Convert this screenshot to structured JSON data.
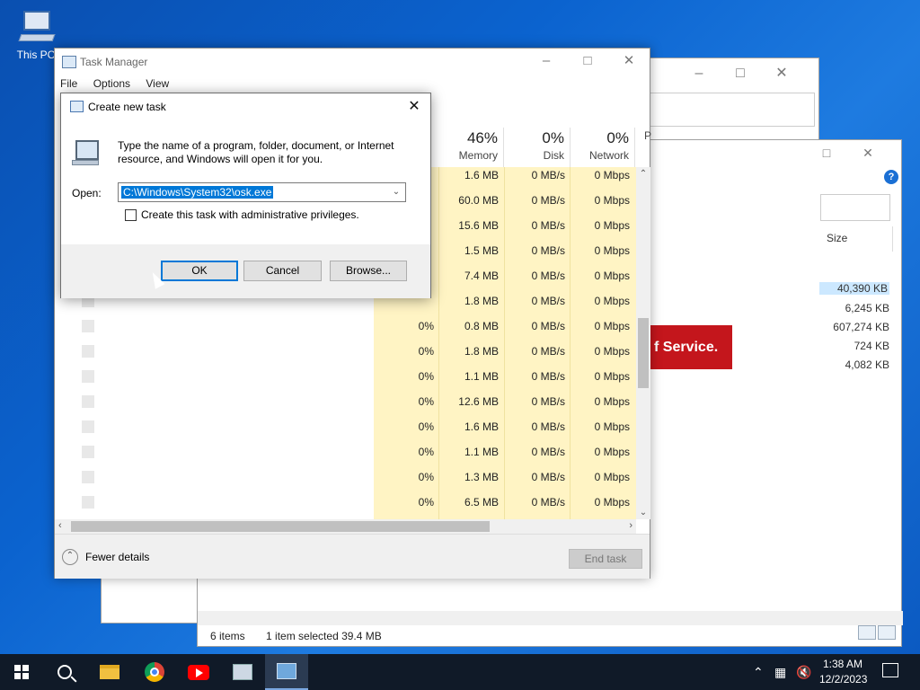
{
  "desktop": {
    "icon_label": "This PC"
  },
  "banner": {
    "text": "f Service."
  },
  "explorer": {
    "sizes_header": "Size",
    "sizes": [
      "40,390 KB",
      "6,245 KB",
      "607,274 KB",
      "724 KB",
      "4,082 KB"
    ],
    "status_items": "6 items",
    "status_selected": "1 item selected  39.4 MB"
  },
  "task_manager": {
    "title": "Task Manager",
    "menu": [
      "File",
      "Options",
      "View"
    ],
    "columns": [
      {
        "pct": "46%",
        "name": "Memory"
      },
      {
        "pct": "0%",
        "name": "Disk"
      },
      {
        "pct": "0%",
        "name": "Network"
      },
      {
        "pct": "",
        "name": "P"
      }
    ],
    "rows": [
      {
        "cpu": "",
        "mem": "1.6 MB",
        "disk": "0 MB/s",
        "net": "0 Mbps"
      },
      {
        "cpu": "",
        "mem": "60.0 MB",
        "disk": "0 MB/s",
        "net": "0 Mbps"
      },
      {
        "cpu": "",
        "mem": "15.6 MB",
        "disk": "0 MB/s",
        "net": "0 Mbps"
      },
      {
        "cpu": "",
        "mem": "1.5 MB",
        "disk": "0 MB/s",
        "net": "0 Mbps"
      },
      {
        "cpu": "",
        "mem": "7.4 MB",
        "disk": "0 MB/s",
        "net": "0 Mbps"
      },
      {
        "cpu": "",
        "mem": "1.8 MB",
        "disk": "0 MB/s",
        "net": "0 Mbps"
      },
      {
        "cpu": "0%",
        "mem": "0.8 MB",
        "disk": "0 MB/s",
        "net": "0 Mbps"
      },
      {
        "cpu": "0%",
        "mem": "1.8 MB",
        "disk": "0 MB/s",
        "net": "0 Mbps"
      },
      {
        "cpu": "0%",
        "mem": "1.1 MB",
        "disk": "0 MB/s",
        "net": "0 Mbps"
      },
      {
        "cpu": "0%",
        "mem": "12.6 MB",
        "disk": "0 MB/s",
        "net": "0 Mbps"
      },
      {
        "cpu": "0%",
        "mem": "1.6 MB",
        "disk": "0 MB/s",
        "net": "0 Mbps"
      },
      {
        "cpu": "0%",
        "mem": "1.1 MB",
        "disk": "0 MB/s",
        "net": "0 Mbps"
      },
      {
        "cpu": "0%",
        "mem": "1.3 MB",
        "disk": "0 MB/s",
        "net": "0 Mbps"
      },
      {
        "cpu": "0%",
        "mem": "6.5 MB",
        "disk": "0 MB/s",
        "net": "0 Mbps"
      }
    ],
    "fewer_details": "Fewer details",
    "end_task": "End task"
  },
  "dialog": {
    "title": "Create new task",
    "description": "Type the name of a program, folder, document, or Internet resource, and Windows will open it for you.",
    "open_label": "Open:",
    "open_value": "C:\\Windows\\System32\\osk.exe",
    "admin_checkbox_label": "Create this task with administrative privileges.",
    "admin_checked": false,
    "ok": "OK",
    "cancel": "Cancel",
    "browse": "Browse..."
  },
  "taskbar": {
    "time": "1:38 AM",
    "date": "12/2/2023",
    "icons": [
      "windows-start-icon",
      "search-icon",
      "file-explorer-icon",
      "chrome-icon",
      "youtube-icon",
      "app-icon",
      "task-manager-icon"
    ]
  }
}
